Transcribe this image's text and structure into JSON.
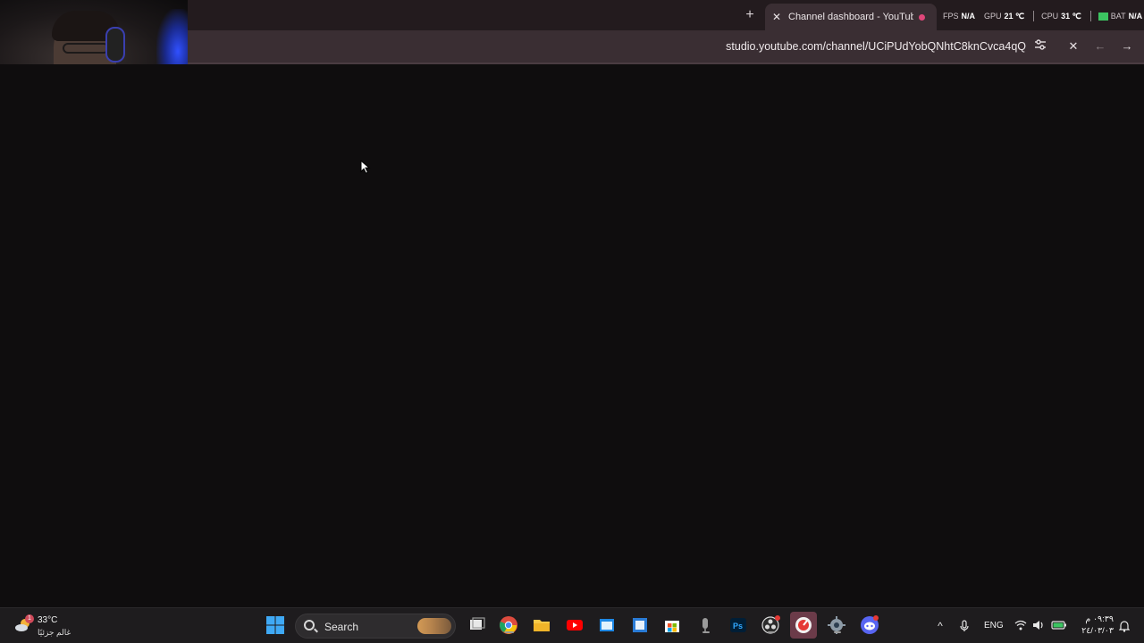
{
  "browser": {
    "tab_title": "Channel dashboard - YouTube",
    "url": "studio.youtube.com/channel/UCiPUdYobQNhtC8knCvca4qQ"
  },
  "overlay": {
    "fps_label": "FPS",
    "fps_value": "N/A",
    "gpu_label": "GPU",
    "gpu_value": "21 ℃",
    "cpu_label": "CPU",
    "cpu_value": "31 ℃",
    "bat_label": "BAT",
    "bat_value": "N/A"
  },
  "taskbar": {
    "weather_temp": "33°C",
    "weather_desc": "غالم جزئيًا",
    "weather_badge": "1",
    "search_label": "Search",
    "language": "ENG",
    "time": "٠٩:٣٩ م",
    "date": "٢٤/٠٣/٠٣"
  },
  "colors": {
    "background": "#0f0d0e",
    "tab_strip": "#231b1e",
    "toolbar": "#3a2e33",
    "taskbar": "#1e1c1e",
    "recording_dot": "#e0477a"
  }
}
